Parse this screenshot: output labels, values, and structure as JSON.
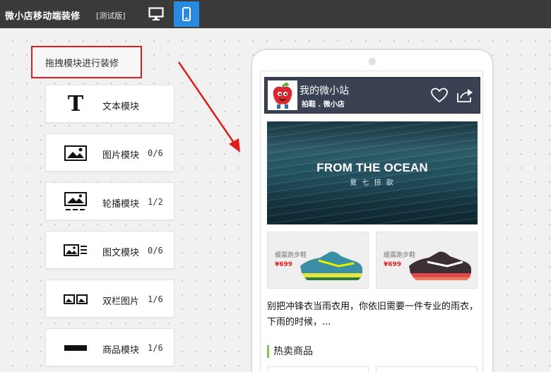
{
  "topbar": {
    "title": "微小店移动端装修",
    "badge": "[测试版]",
    "desktop_icon": "monitor-icon",
    "mobile_icon": "phone-icon",
    "active_color": "#2a8ae0"
  },
  "sidebar": {
    "hint": "拖拽模块进行装修",
    "modules": [
      {
        "label": "文本模块",
        "count": "",
        "icon": "text-icon"
      },
      {
        "label": "图片模块",
        "count": "0/6",
        "icon": "image-icon"
      },
      {
        "label": "轮播模块",
        "count": "1/2",
        "icon": "carousel-icon"
      },
      {
        "label": "图文模块",
        "count": "0/6",
        "icon": "image-text-icon"
      },
      {
        "label": "双栏图片",
        "count": "1/6",
        "icon": "two-column-image-icon"
      },
      {
        "label": "商品模块",
        "count": "1/6",
        "icon": "product-icon"
      }
    ]
  },
  "preview": {
    "shop": {
      "name": "我的微小站",
      "subtitle": "拍鞋 . 微小店",
      "logo_icon": "apple-mascot-icon",
      "header_color": "#3a4152"
    },
    "banner": {
      "title": "FROM THE OCEAN",
      "subtitle": "夏 七 掠 歆"
    },
    "products": [
      {
        "name": "缓震跑步鞋",
        "price": "¥699",
        "shoe_color": "#3a8fa4"
      },
      {
        "name": "缓震跑步鞋",
        "price": "¥699",
        "shoe_color": "#3c2f33"
      }
    ],
    "description": "别把冲锋衣当雨衣用，你依旧需要一件专业的雨衣，下雨的时候，...",
    "section_title": "热卖商品",
    "accent_color": "#8bc34a"
  }
}
